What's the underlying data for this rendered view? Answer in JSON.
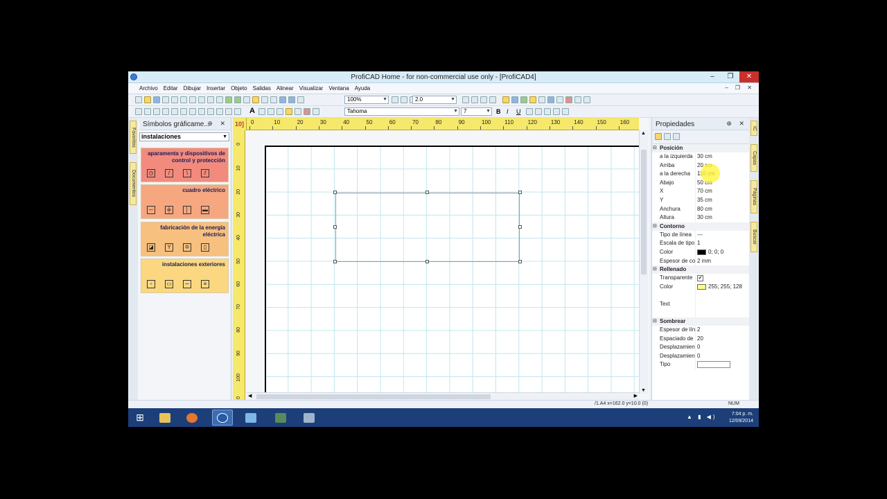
{
  "window": {
    "title": "ProfiCAD Home - for non-commercial use only - [ProfiCAD4]",
    "controls": {
      "minimize": "‒",
      "maximize": "❐",
      "close": "✕"
    }
  },
  "menu": {
    "items": [
      "Archivo",
      "Editar",
      "Dibujar",
      "Insertar",
      "Objeto",
      "Salidas",
      "Alinear",
      "Visualizar",
      "Ventana",
      "Ayuda"
    ],
    "mdi_controls": "‒ ❐ ✕"
  },
  "toolbar1": {
    "zoom": "100%",
    "line_width": "2.0"
  },
  "toolbar2": {
    "font": "Tahoma",
    "font_size": "7",
    "bold": "B",
    "italic": "I",
    "underline": "U",
    "text_tool": "A"
  },
  "symbols_panel": {
    "title": "Símbolos gráficame...",
    "controls": "⊕ ✕",
    "category_select": "instalaciones",
    "categories": [
      {
        "label": "aparamenta y dispositivos de control y protección"
      },
      {
        "label": "cuadro eléctrico"
      },
      {
        "label": "fabricación de la energía eléctrica"
      },
      {
        "label": "instalaciones exteriores"
      }
    ]
  },
  "left_tabs": [
    "Favoritos",
    "Documentos"
  ],
  "canvas": {
    "ruler_corner": "10]",
    "ruler_h": [
      "0",
      "10",
      "20",
      "30",
      "40",
      "50",
      "60",
      "70",
      "80",
      "90",
      "100",
      "110",
      "120",
      "130",
      "140",
      "150",
      "160"
    ],
    "ruler_v": [
      "0",
      "10",
      "20",
      "30",
      "40",
      "50",
      "60",
      "70",
      "80",
      "90",
      "100",
      "0"
    ]
  },
  "properties_panel": {
    "title": "Propiedades",
    "controls": "⊕ ✕",
    "sections": [
      {
        "name": "Posición",
        "rows": [
          {
            "key": "a la izquierda",
            "value": "30 cm"
          },
          {
            "key": "Arriba",
            "value": "20 cm"
          },
          {
            "key": "a la derecha",
            "value": "110 cm"
          },
          {
            "key": "Abajo",
            "value": "50 cm"
          },
          {
            "key": "X",
            "value": "70 cm"
          },
          {
            "key": "Y",
            "value": "35 cm"
          },
          {
            "key": "Anchura",
            "value": "80 cm"
          },
          {
            "key": "Altura",
            "value": "30 cm"
          }
        ]
      },
      {
        "name": "Contorno",
        "rows": [
          {
            "key": "Tipo de línea",
            "value": "---"
          },
          {
            "key": "Escala de tipo de",
            "value": "1"
          },
          {
            "key": "Color",
            "value": "0; 0; 0",
            "swatch": "#000000"
          },
          {
            "key": "Espesor de conto",
            "value": "2 mm"
          }
        ]
      },
      {
        "name": "Rellenado",
        "rows": [
          {
            "key": "Transparente",
            "value": "✔",
            "checkbox": true
          },
          {
            "key": "Color",
            "value": "255; 255; 128",
            "swatch": "#ffff80"
          },
          {
            "key": "",
            "value": ""
          },
          {
            "key": "Text",
            "value": ""
          },
          {
            "key": "",
            "value": ""
          }
        ]
      },
      {
        "name": "Sombrear",
        "rows": [
          {
            "key": "Espesor de líneas",
            "value": "2"
          },
          {
            "key": "Espaciado de líne",
            "value": "20"
          },
          {
            "key": "Desplazamiento :",
            "value": "0"
          },
          {
            "key": "Desplazamiento :",
            "value": "0"
          },
          {
            "key": "Tipo",
            "value": "",
            "box": true
          }
        ]
      }
    ]
  },
  "right_tabs": [
    "IC",
    "Capas",
    "Páginas",
    "Buscar"
  ],
  "status": {
    "coords": "/1.A4  x=162.0  y=10.0 (0)",
    "num": "NUM"
  },
  "taskbar": {
    "time": "7:04 p. m.",
    "date": "12/09/2014",
    "tray": "▲ ▮ ◀)"
  },
  "colors": {
    "title_bg": "#d8ecf8",
    "close_btn": "#c9302c",
    "ruler": "#f6e86a",
    "grid": "#bfe6ee",
    "taskbar": "#1c3f7a"
  }
}
